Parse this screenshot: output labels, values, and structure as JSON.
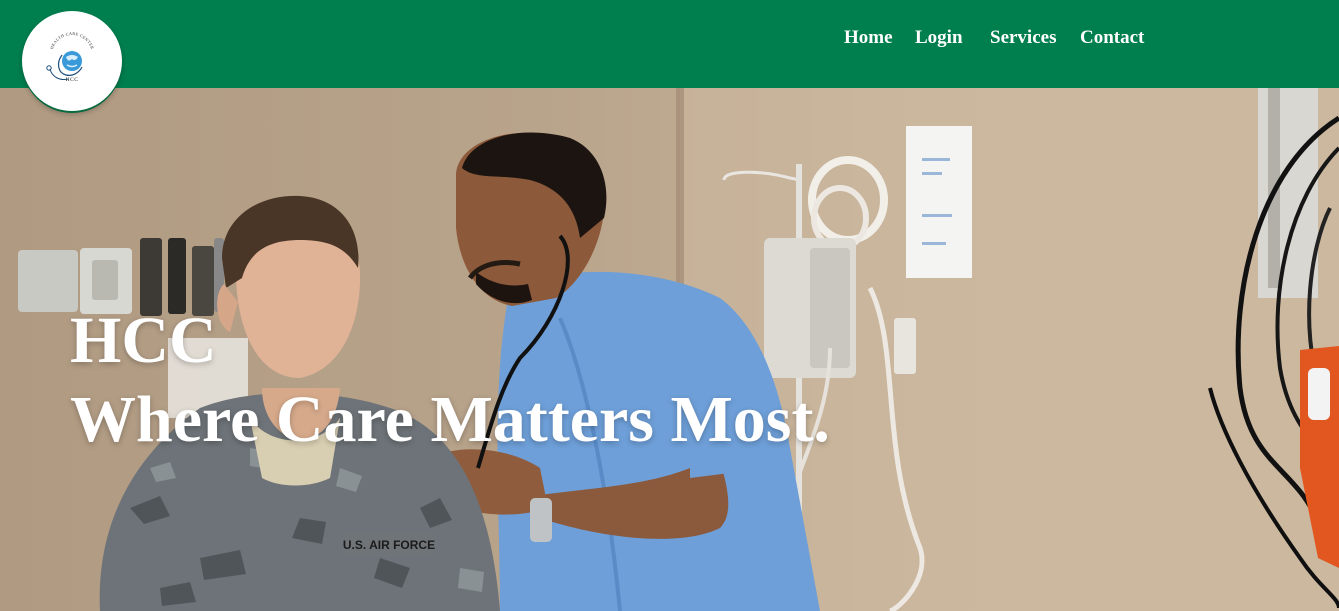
{
  "brand": {
    "logo_text": "HCC",
    "logo_arc_text": "HEALTH CARE CENTER"
  },
  "nav": {
    "items": [
      {
        "label": "Home"
      },
      {
        "label": "Login"
      },
      {
        "label": "Services"
      },
      {
        "label": "Contact"
      }
    ]
  },
  "hero": {
    "title": "HCC",
    "tagline": "Where Care Matters Most.",
    "uniform_tag": "U.S. AIR FORCE"
  },
  "colors": {
    "header_bg": "#007f4e",
    "nav_text": "#ffffff",
    "hero_text": "#ffffff",
    "scrubs": "#6e9fd8"
  },
  "icons": {
    "logo": "stethoscope-globe-icon"
  }
}
